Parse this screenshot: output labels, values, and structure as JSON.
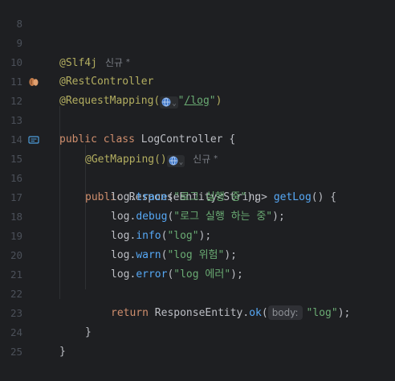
{
  "editor": {
    "lines": [
      {
        "num": "8"
      },
      {
        "num": "9",
        "annotation": "@Slf4j",
        "author_hint": "신규",
        "star": "*"
      },
      {
        "num": "10",
        "annotation": "@RestController"
      },
      {
        "num": "11",
        "annotation": "@RequestMapping(",
        "path_q1": "\"",
        "path": "/log",
        "path_q2": "\"",
        "close": ")"
      },
      {
        "num": "12",
        "kw1": "public",
        "kw2": "class",
        "name": "LogController",
        "brace": "{"
      },
      {
        "num": "13"
      },
      {
        "num": "14",
        "annotation": "@GetMapping()",
        "author_hint": "신규",
        "star": "*"
      },
      {
        "num": "15",
        "kw1": "public",
        "type": "ResponseEntity<String>",
        "method": "getLog",
        "rest": "() {"
      },
      {
        "num": "16",
        "obj": "log.",
        "method": "trace",
        "open": "(",
        "arg": "\"로그 실행 중\"",
        "close": ");"
      },
      {
        "num": "17",
        "obj": "log.",
        "method": "debug",
        "open": "(",
        "arg": "\"로그 실행 하는 중\"",
        "close": ");"
      },
      {
        "num": "18",
        "obj": "log.",
        "method": "info",
        "open": "(",
        "arg": "\"log\"",
        "close": ");"
      },
      {
        "num": "19",
        "obj": "log.",
        "method": "warn",
        "open": "(",
        "arg": "\"log 위험\"",
        "close": ");"
      },
      {
        "num": "20",
        "obj": "log.",
        "method": "error",
        "open": "(",
        "arg": "\"log 에러\"",
        "close": ");"
      },
      {
        "num": "21"
      },
      {
        "num": "22",
        "kw": "return",
        "obj": "ResponseEntity.",
        "method": "ok",
        "open": "(",
        "param_hint": "body:",
        "arg": "\"log\"",
        "close": ");"
      },
      {
        "num": "23",
        "brace": "}"
      },
      {
        "num": "24",
        "brace": "}"
      },
      {
        "num": "25"
      }
    ]
  },
  "colors": {
    "background": "#1e1f22",
    "keyword": "#cf8e6d",
    "annotation": "#b3ae60",
    "string": "#6aab73",
    "method": "#56a8f5",
    "text": "#bcbec4",
    "line_number": "#4b5059"
  },
  "icons": {
    "line12_gutter": "bean-icon",
    "line15_gutter": "endpoint-icon",
    "line11_inline": "globe-icon",
    "line14_inline": "globe-icon"
  }
}
